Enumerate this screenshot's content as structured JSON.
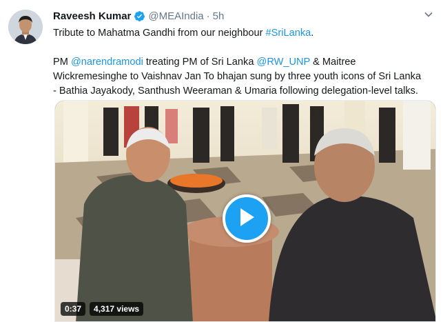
{
  "tweet": {
    "author_name": "Raveesh Kumar",
    "handle": "@MEAIndia",
    "separator": "·",
    "time": "5h",
    "line1_text": "Tribute to Mahatma Gandhi from our neighbour ",
    "line1_hashtag": "#SriLanka",
    "line1_end": ".",
    "line2_a": "PM ",
    "line2_mention1": "@narendramodi",
    "line2_b": " treating PM of Sri Lanka ",
    "line2_mention2": "@RW_UNP",
    "line2_c": " & Maitree",
    "line3": "Wickremesinghe to Vaishnav Jan To bhajan sung by three youth icons of Sri Lanka",
    "line4": "- Bathia Jayakody, Santhush Weeraman & Umaria following delegation-level talks."
  },
  "video": {
    "duration": "0:37",
    "views": "4,317 views"
  },
  "icons": {
    "verified": "verified-badge-icon",
    "caret": "chevron-down-icon",
    "play": "play-icon"
  },
  "colors": {
    "link": "#1b95e0",
    "play_button": "#1da1f2",
    "muted_text": "#657786"
  }
}
